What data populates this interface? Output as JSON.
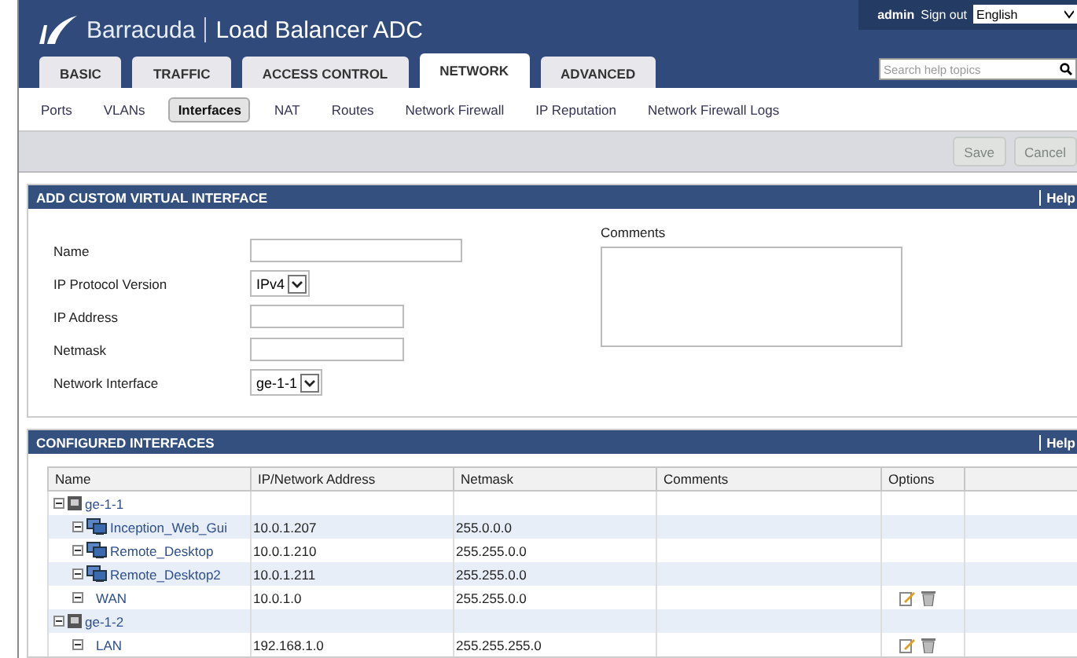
{
  "header": {
    "brand": "Barracuda",
    "product": "Load Balancer ADC",
    "user": "admin",
    "sign_out": "Sign out",
    "language": "English",
    "search": {
      "placeholder": "Search help topics"
    }
  },
  "tabs": [
    {
      "label": "BASIC",
      "selected": false
    },
    {
      "label": "TRAFFIC",
      "selected": false
    },
    {
      "label": "ACCESS CONTROL",
      "selected": false
    },
    {
      "label": "NETWORK",
      "selected": true
    },
    {
      "label": "ADVANCED",
      "selected": false
    }
  ],
  "subnav": [
    {
      "label": "Ports",
      "selected": false
    },
    {
      "label": "VLANs",
      "selected": false
    },
    {
      "label": "Interfaces",
      "selected": true
    },
    {
      "label": "NAT",
      "selected": false
    },
    {
      "label": "Routes",
      "selected": false
    },
    {
      "label": "Network Firewall",
      "selected": false
    },
    {
      "label": "IP Reputation",
      "selected": false
    },
    {
      "label": "Network Firewall Logs",
      "selected": false
    }
  ],
  "actions": [
    {
      "label": "Save",
      "disabled": true
    },
    {
      "label": "Cancel",
      "disabled": true
    }
  ],
  "add_section": {
    "title": "ADD CUSTOM VIRTUAL INTERFACE",
    "help": "Help",
    "fields": [
      {
        "label": "Name",
        "kind": "text"
      },
      {
        "label": "IP Protocol Version",
        "kind": "select",
        "value": "IPv4"
      },
      {
        "label": "IP Address",
        "kind": "text"
      },
      {
        "label": "Netmask",
        "kind": "text"
      },
      {
        "label": "Network Interface",
        "kind": "select",
        "value": "ge-1-1"
      }
    ],
    "comments_label": "Comments"
  },
  "configured": {
    "title": "CONFIGURED INTERFACES",
    "help": "Help",
    "columns": [
      "Name",
      "IP/Network Address",
      "Netmask",
      "Comments",
      "Options"
    ],
    "rows": [
      {
        "name": "ge-1-1",
        "kind": "port",
        "expanded": true,
        "children": [
          {
            "name": "Inception_Web_Gui",
            "kind": "virtual",
            "expanded": true,
            "ip": "10.0.1.207",
            "netmask": "255.0.0.0",
            "editable": false
          },
          {
            "name": "Remote_Desktop",
            "kind": "virtual",
            "expanded": true,
            "ip": "10.0.1.210",
            "netmask": "255.255.0.0",
            "editable": false
          },
          {
            "name": "Remote_Desktop2",
            "kind": "virtual",
            "expanded": true,
            "ip": "10.0.1.211",
            "netmask": "255.255.0.0",
            "editable": false
          },
          {
            "name": "WAN",
            "kind": "plain",
            "expanded": true,
            "ip": "10.0.1.0",
            "netmask": "255.255.0.0",
            "editable": true
          }
        ]
      },
      {
        "name": "ge-1-2",
        "kind": "port",
        "expanded": true,
        "children": [
          {
            "name": "LAN",
            "kind": "plain",
            "expanded": true,
            "ip": "192.168.1.0",
            "netmask": "255.255.255.0",
            "editable": true
          }
        ]
      }
    ]
  }
}
